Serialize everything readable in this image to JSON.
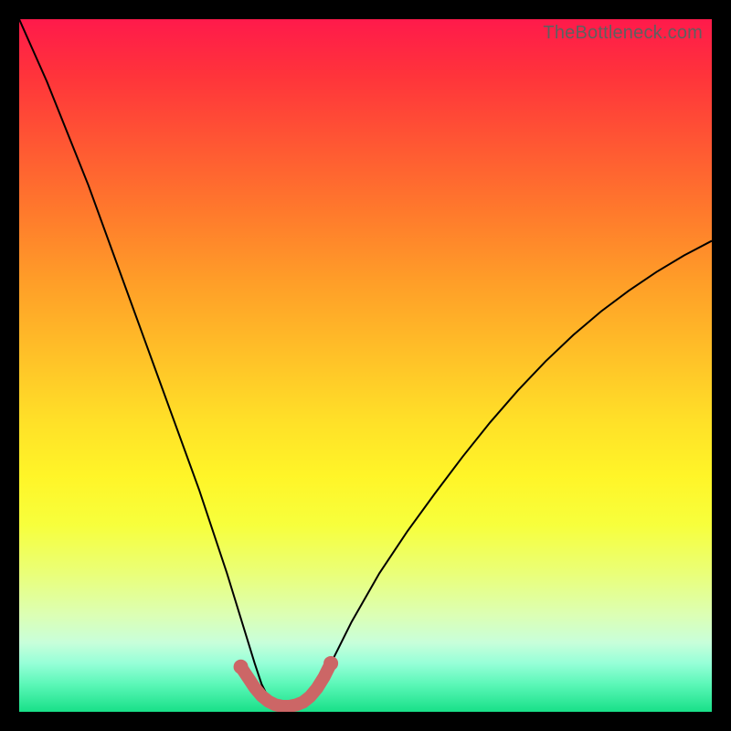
{
  "watermark": "TheBottleneck.com",
  "chart_data": {
    "type": "line",
    "title": "",
    "xlabel": "",
    "ylabel": "",
    "xlim": [
      0,
      100
    ],
    "ylim": [
      0,
      100
    ],
    "x": [
      0,
      2,
      4,
      6,
      8,
      10,
      12,
      14,
      16,
      18,
      20,
      22,
      24,
      26,
      28,
      30,
      32,
      34,
      35,
      36,
      37,
      38,
      39,
      40,
      41,
      42,
      43,
      44,
      46,
      48,
      52,
      56,
      60,
      64,
      68,
      72,
      76,
      80,
      84,
      88,
      92,
      96,
      100
    ],
    "values": [
      100,
      95.5,
      91,
      86,
      81,
      76,
      70.5,
      65,
      59.5,
      54,
      48.5,
      43,
      37.5,
      32,
      26,
      20,
      13.5,
      7,
      4,
      2,
      1,
      0.5,
      0.5,
      0.5,
      0.8,
      1.5,
      3,
      5,
      9,
      13,
      20,
      26,
      31.5,
      36.8,
      41.8,
      46.4,
      50.6,
      54.4,
      57.8,
      60.8,
      63.5,
      65.9,
      68
    ],
    "marker_region_x": [
      32,
      33,
      34,
      35,
      36,
      37,
      38,
      39,
      40,
      41,
      42,
      43,
      44,
      45
    ],
    "marker_region_y": [
      6.5,
      5,
      3.5,
      2.3,
      1.5,
      1,
      0.8,
      0.8,
      1,
      1.4,
      2.2,
      3.4,
      5,
      7
    ],
    "colors": {
      "curve": "#000000",
      "marker": "#cc6666",
      "background_top": "#ff1a4b",
      "background_bottom": "#18e088"
    }
  }
}
